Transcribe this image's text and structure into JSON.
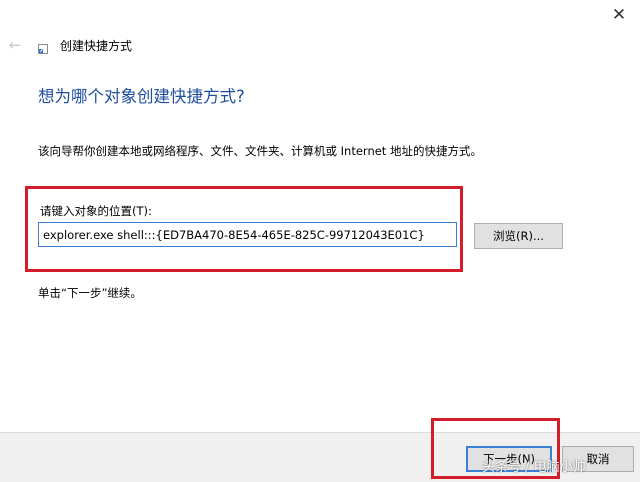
{
  "window": {
    "close_icon": "close-icon",
    "close_glyph": "✕",
    "back_icon": "back-arrow-icon",
    "back_glyph": "←",
    "title": "创建快捷方式"
  },
  "main": {
    "heading": "想为哪个对象创建快捷方式?",
    "description": "该向导帮你创建本地或网络程序、文件、文件夹、计算机或 Internet 地址的快捷方式。",
    "location_label": "请键入对象的位置(T):",
    "location_value": "explorer.exe shell:::{ED7BA470-8E54-465E-825C-99712043E01C}",
    "browse_label": "浏览(R)...",
    "hint": "单击“下一步”继续。"
  },
  "footer": {
    "next_label": "下一步(N)",
    "cancel_label": "取消"
  },
  "annotations": {
    "highlight_color": "#d31d2a"
  },
  "watermark": "头条号 / 电脑小帅",
  "colors": {
    "heading": "#1f4e9e",
    "input_border": "#3c7fd6",
    "button_bg": "#e1e1e1",
    "footer_bg": "#f0f0f0"
  }
}
